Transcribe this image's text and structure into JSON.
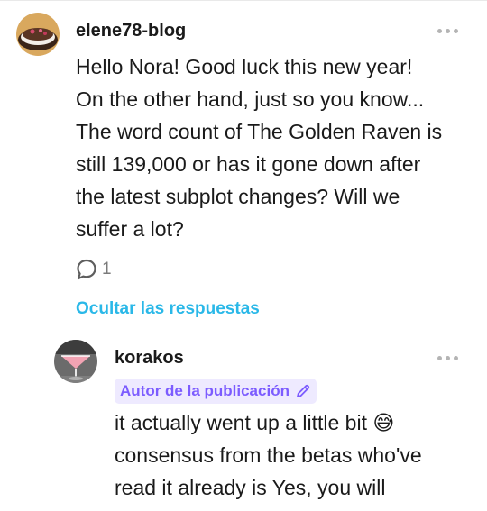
{
  "comment": {
    "username": "elene78-blog",
    "avatar_icon": "cake-avatar",
    "lines": [
      "Hello Nora! Good luck this new year!",
      "On the other hand, just so you know...",
      "The word count of The Golden Raven is",
      "still 139,000 or has it gone down after",
      "the latest subplot changes? Will we",
      "suffer a lot?"
    ],
    "reply_count": "1",
    "hide_replies_label": "Ocultar las respuestas"
  },
  "reply": {
    "username": "korakos",
    "avatar_icon": "cocktail-avatar",
    "badge_label": "Autor de la publicación",
    "lines": [
      "it actually went up a little bit 😅",
      "consensus from the betas who've",
      "read it already is Yes, you will"
    ]
  },
  "colors": {
    "link": "#2ab8e8",
    "badge_bg": "#eeeaff",
    "badge_text": "#7c5cff",
    "muted": "#7a7a7a"
  }
}
